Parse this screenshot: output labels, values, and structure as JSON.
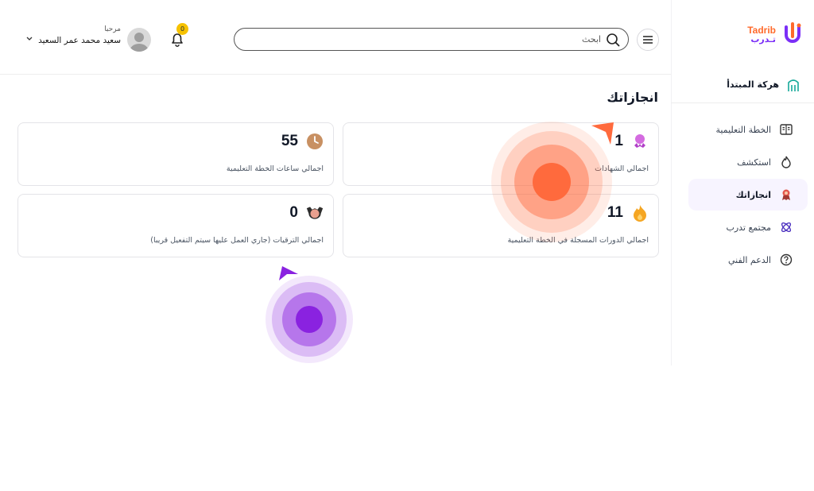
{
  "brand": {
    "name_en": "Tadrib",
    "name_ar": "تـدرب"
  },
  "org": {
    "label": "هركة المبتدأ"
  },
  "nav": {
    "items": [
      {
        "label": "الخطة التعليمية",
        "icon": "book-icon"
      },
      {
        "label": "استكشف",
        "icon": "flame-icon"
      },
      {
        "label": "انجازاتك",
        "icon": "medal-icon",
        "active": true
      },
      {
        "label": "مجتمع تدرب",
        "icon": "atom-icon"
      },
      {
        "label": "الدعم الفني",
        "icon": "help-icon"
      }
    ]
  },
  "header": {
    "search_placeholder": "ابحث",
    "notifications_count": "0",
    "greeting": "مرحبا",
    "user_name": "سعيد محمد عمر السعيد"
  },
  "page": {
    "title": "انجازاتك"
  },
  "cards": [
    {
      "value": "1",
      "label": "اجمالي الشهادات",
      "icon": "certificate-icon",
      "icon_color": "#c74bd9"
    },
    {
      "value": "55",
      "label": "اجمالي ساعات الخطة التعليمية",
      "icon": "clock-icon",
      "icon_color": "#c89062"
    },
    {
      "value": "11",
      "label": "اجمالي الدورات المسجلة في الخطة التعليمية",
      "icon": "fire-icon",
      "icon_color": "#f5a623"
    },
    {
      "value": "0",
      "label": "اجمالي الترقيات (جاري العمل عليها سيتم التفعيل قريبا)",
      "icon": "emblem-icon",
      "icon_color": "#e07a6a"
    }
  ],
  "colors": {
    "accent": "#7b2ff7",
    "brand_orange": "#ff6a2b",
    "click_orange": "#ff6a3d",
    "click_purple": "#8a22e0"
  }
}
